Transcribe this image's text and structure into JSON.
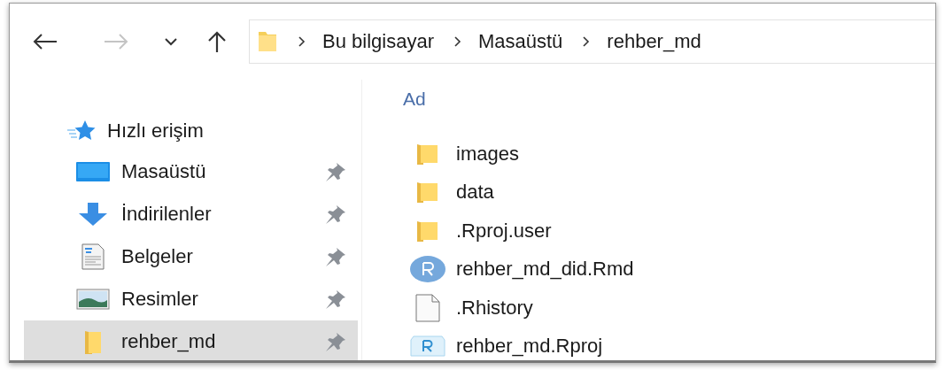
{
  "nav": [
    {
      "kind": "back",
      "disabled": false
    },
    {
      "kind": "forward",
      "disabled": true
    },
    {
      "kind": "recent",
      "disabled": false
    },
    {
      "kind": "up",
      "disabled": false
    }
  ],
  "breadcrumb": [
    "Bu bilgisayar",
    "Masaüstü",
    "rehber_md"
  ],
  "sidebar": {
    "header": "Hızlı erişim",
    "items": [
      {
        "label": "Masaüstü",
        "kind": "desktop",
        "pinned": true,
        "selected": false
      },
      {
        "label": "İndirilenler",
        "kind": "download",
        "pinned": true,
        "selected": false
      },
      {
        "label": "Belgeler",
        "kind": "documents",
        "pinned": true,
        "selected": false
      },
      {
        "label": "Resimler",
        "kind": "pictures",
        "pinned": true,
        "selected": false
      },
      {
        "label": "rehber_md",
        "kind": "folder",
        "pinned": true,
        "selected": true
      }
    ]
  },
  "files": {
    "column": "Ad",
    "rows": [
      {
        "name": "images",
        "kind": "folder"
      },
      {
        "name": "data",
        "kind": "folder"
      },
      {
        "name": ".Rproj.user",
        "kind": "folder"
      },
      {
        "name": "rehber_md_did.Rmd",
        "kind": "rmd"
      },
      {
        "name": ".Rhistory",
        "kind": "file"
      },
      {
        "name": "rehber_md.Rproj",
        "kind": "rproj"
      }
    ]
  }
}
